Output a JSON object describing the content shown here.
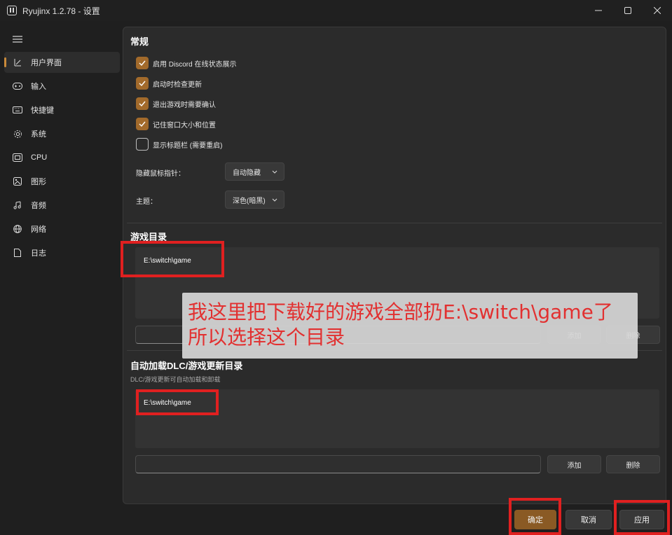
{
  "window": {
    "title": "Ryujinx 1.2.78 - 设置",
    "controls": [
      "minimize-icon",
      "maximize-icon",
      "close-icon"
    ]
  },
  "sidebar": {
    "menu_icon": "hamburger-icon",
    "items": [
      {
        "label": "用户界面",
        "icon": "ui-icon",
        "active": true
      },
      {
        "label": "输入",
        "icon": "gamepad-icon",
        "active": false
      },
      {
        "label": "快捷键",
        "icon": "keyboard-icon",
        "active": false
      },
      {
        "label": "系统",
        "icon": "gear-icon",
        "active": false
      },
      {
        "label": "CPU",
        "icon": "cpu-icon",
        "active": false
      },
      {
        "label": "图形",
        "icon": "image-icon",
        "active": false
      },
      {
        "label": "音频",
        "icon": "music-icon",
        "active": false
      },
      {
        "label": "网络",
        "icon": "globe-icon",
        "active": false
      },
      {
        "label": "日志",
        "icon": "document-icon",
        "active": false
      }
    ]
  },
  "general": {
    "title": "常规",
    "checkboxes": [
      {
        "label": "启用 Discord 在线状态展示",
        "checked": true
      },
      {
        "label": "启动时检查更新",
        "checked": true
      },
      {
        "label": "退出游戏时需要确认",
        "checked": true
      },
      {
        "label": "记住窗口大小和位置",
        "checked": true
      },
      {
        "label": "显示标题栏 (需要重启)",
        "checked": false
      }
    ],
    "hide_cursor_label": "隐藏鼠标指针：",
    "hide_cursor_value": "自动隐藏",
    "theme_label": "主题：",
    "theme_value": "深色(暗黑)"
  },
  "game_dirs": {
    "title": "游戏目录",
    "entries": [
      "E:\\switch\\game"
    ],
    "add_label": "添加",
    "remove_label": "删除"
  },
  "dlc_dirs": {
    "title": "自动加载DLC/游戏更新目录",
    "subtitle": "DLC/游戏更新可自动加载和卸载",
    "entries": [
      "E:\\switch\\game"
    ],
    "add_label": "添加",
    "remove_label": "删除"
  },
  "annotation": {
    "text": "我这里把下载好的游戏全部扔E:\\switch\\game了\n所以选择这个目录"
  },
  "footer": {
    "ok_label": "确定",
    "cancel_label": "取消",
    "apply_label": "应用"
  },
  "colors": {
    "accent": "#a26a2b",
    "annotation_red": "#e02020"
  }
}
